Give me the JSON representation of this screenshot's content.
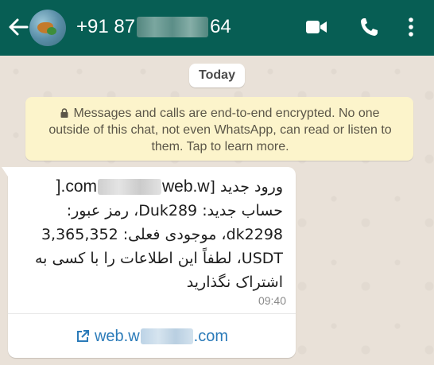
{
  "header": {
    "phone_prefix": "+91 87",
    "phone_suffix": "64"
  },
  "icons": {
    "back": "arrow-left-icon",
    "video": "video-call-icon",
    "call": "phone-call-icon",
    "menu": "more-vert-icon",
    "lock": "lock-icon",
    "link": "external-link-icon"
  },
  "colors": {
    "header": "#075e54",
    "notice": "#fcf4cb",
    "link": "#2b7bb9"
  },
  "date_chip": "Today",
  "encryption_notice": {
    "line1": "Messages and calls are end-to-end encrypted. No one",
    "line2": "outside of this chat, not even WhatsApp, can read or listen to",
    "line3": "them. Tap to learn more."
  },
  "message": {
    "line1_prefix": "ورود جدید [ ",
    "url_start": "web.w",
    "url_end": ".com",
    "line1_suffix": " ]",
    "line2": "حساب جدید: Duk289، رمز عبور:",
    "line3": "dk2298، موجودی فعلی: 3,365,352",
    "line4": "USDT، لطفاً این اطلاعات را با کسی به",
    "line5": "اشتراک نگذارید",
    "time": "09:40"
  },
  "link_preview": {
    "url_start": "web.w",
    "url_end": ".com"
  }
}
